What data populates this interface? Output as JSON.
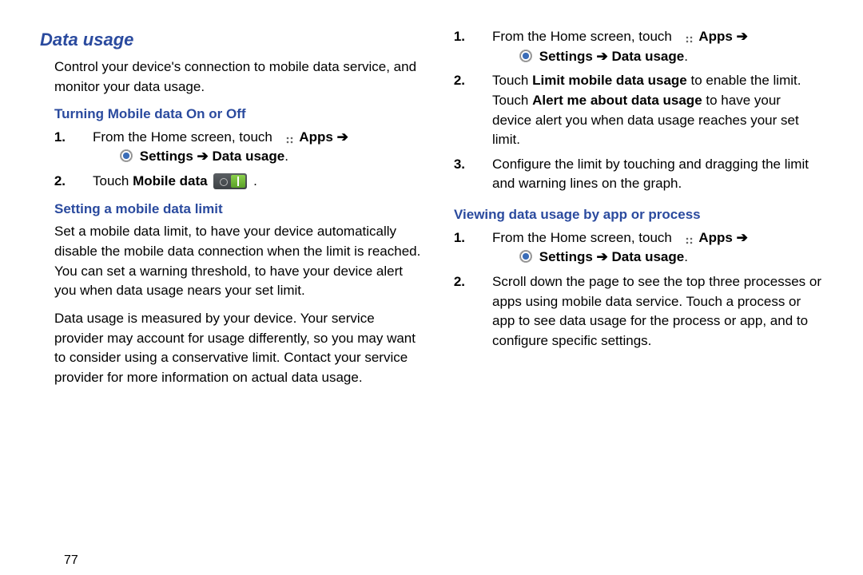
{
  "page_number": "77",
  "left": {
    "h1": "Data usage",
    "intro": "Control your device's connection to mobile data service, and monitor your data usage.",
    "sec1_h": "Turning Mobile data On or Off",
    "sec1_steps": {
      "s1_a": "From the Home screen, touch ",
      "apps": "Apps",
      "arrow": "➔",
      "settings": "Settings",
      "datausage": "Data usage",
      "s2_a": "Touch ",
      "mobiledata": "Mobile data",
      "period": "."
    },
    "sec2_h": "Setting a mobile data limit",
    "sec2_p1": "Set a mobile data limit, to have your device automatically disable the mobile data connection when the limit is reached. You can set a warning threshold, to have your device alert you when data usage nears your set limit.",
    "sec2_p2": "Data usage is measured by your device. Your service provider may account for usage differently, so you may want to consider using a conservative limit. Contact your service provider for more information on actual data usage."
  },
  "right": {
    "steps1": {
      "s1_a": "From the Home screen, touch ",
      "apps": "Apps",
      "arrow": "➔",
      "settings": "Settings",
      "datausage": "Data usage",
      "s2_a": "Touch ",
      "s2_b": "Limit mobile data usage",
      "s2_c": " to enable the limit. Touch ",
      "s2_d": "Alert me about data usage",
      "s2_e": " to have your device alert you when data usage reaches your set limit.",
      "s3": "Configure the limit by touching and dragging the limit and warning lines on the graph."
    },
    "sec3_h": "Viewing data usage by app or process",
    "steps2": {
      "s1_a": "From the Home screen, touch ",
      "apps": "Apps",
      "arrow": "➔",
      "settings": "Settings",
      "datausage": "Data usage",
      "s2": "Scroll down the page to see the top three processes or apps using mobile data service. Touch a process or app to see data usage for the process or app, and to configure specific settings."
    }
  }
}
